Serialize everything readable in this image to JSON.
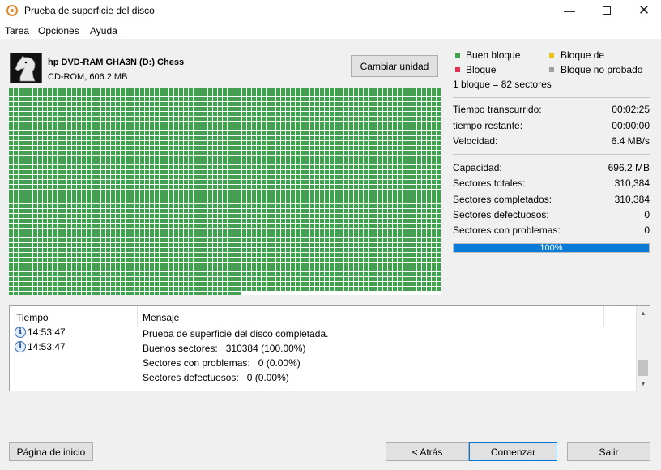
{
  "window": {
    "title": "Prueba de superficie del disco",
    "minimize": "—",
    "close": "✕"
  },
  "menu": [
    "Tarea",
    "Opciones",
    "Ayuda"
  ],
  "drive": {
    "name": "hp DVD-RAM GHA3N (D:) Chess",
    "type": "CD-ROM, 606.2 MB",
    "change_button": "Cambiar unidad",
    "icon": "chess-knight-icon"
  },
  "legend": {
    "good": {
      "label": "Buen bloque",
      "color": "#3fa34d"
    },
    "partial": {
      "label": "Bloque de",
      "color": "#e8c21a"
    },
    "bad": {
      "label": "Bloque",
      "color": "#e0344c"
    },
    "untested": {
      "label": "Bloque no probado",
      "color": "#a0a0a0"
    },
    "block_info": "1 bloque = 82 sectores"
  },
  "block_map": {
    "total_blocks": 3786,
    "good_blocks": 3786,
    "good_color": "#3fa34d",
    "empty_color": "#ffffff"
  },
  "stats": {
    "elapsed_label": "Tiempo transcurrido:",
    "elapsed_value": "00:02:25",
    "remaining_label": "tiempo restante:",
    "remaining_value": "00:00:00",
    "speed_label": "Velocidad:",
    "speed_value": "6.4 MB/s",
    "capacity_label": "Capacidad:",
    "capacity_value": "696.2 MB",
    "total_sectors_label": "Sectores totales:",
    "total_sectors_value": "310,384",
    "completed_sectors_label": "Sectores completados:",
    "completed_sectors_value": "310,384",
    "bad_sectors_label": "Sectores defectuosos:",
    "bad_sectors_value": "0",
    "problem_sectors_label": "Sectores con problemas:",
    "problem_sectors_value": "0"
  },
  "progress": {
    "value": 1.0,
    "text": "100%",
    "color": "#0a7bd6"
  },
  "log": {
    "col_time": "Tiempo",
    "col_message": "Mensaje",
    "rows": [
      {
        "time": "14:53:47",
        "message": "Prueba de superficie del disco completada."
      },
      {
        "time": "14:53:47",
        "message": "Buenos sectores:   310384 (100.00%)"
      },
      {
        "time": "",
        "message": "Sectores con problemas:   0 (0.00%)"
      },
      {
        "time": "",
        "message": "Sectores defectuosos:   0 (0.00%)"
      }
    ]
  },
  "buttons": {
    "home": "Página de inicio",
    "back": "< Atrás",
    "start": "Comenzar",
    "exit": "Salir"
  }
}
